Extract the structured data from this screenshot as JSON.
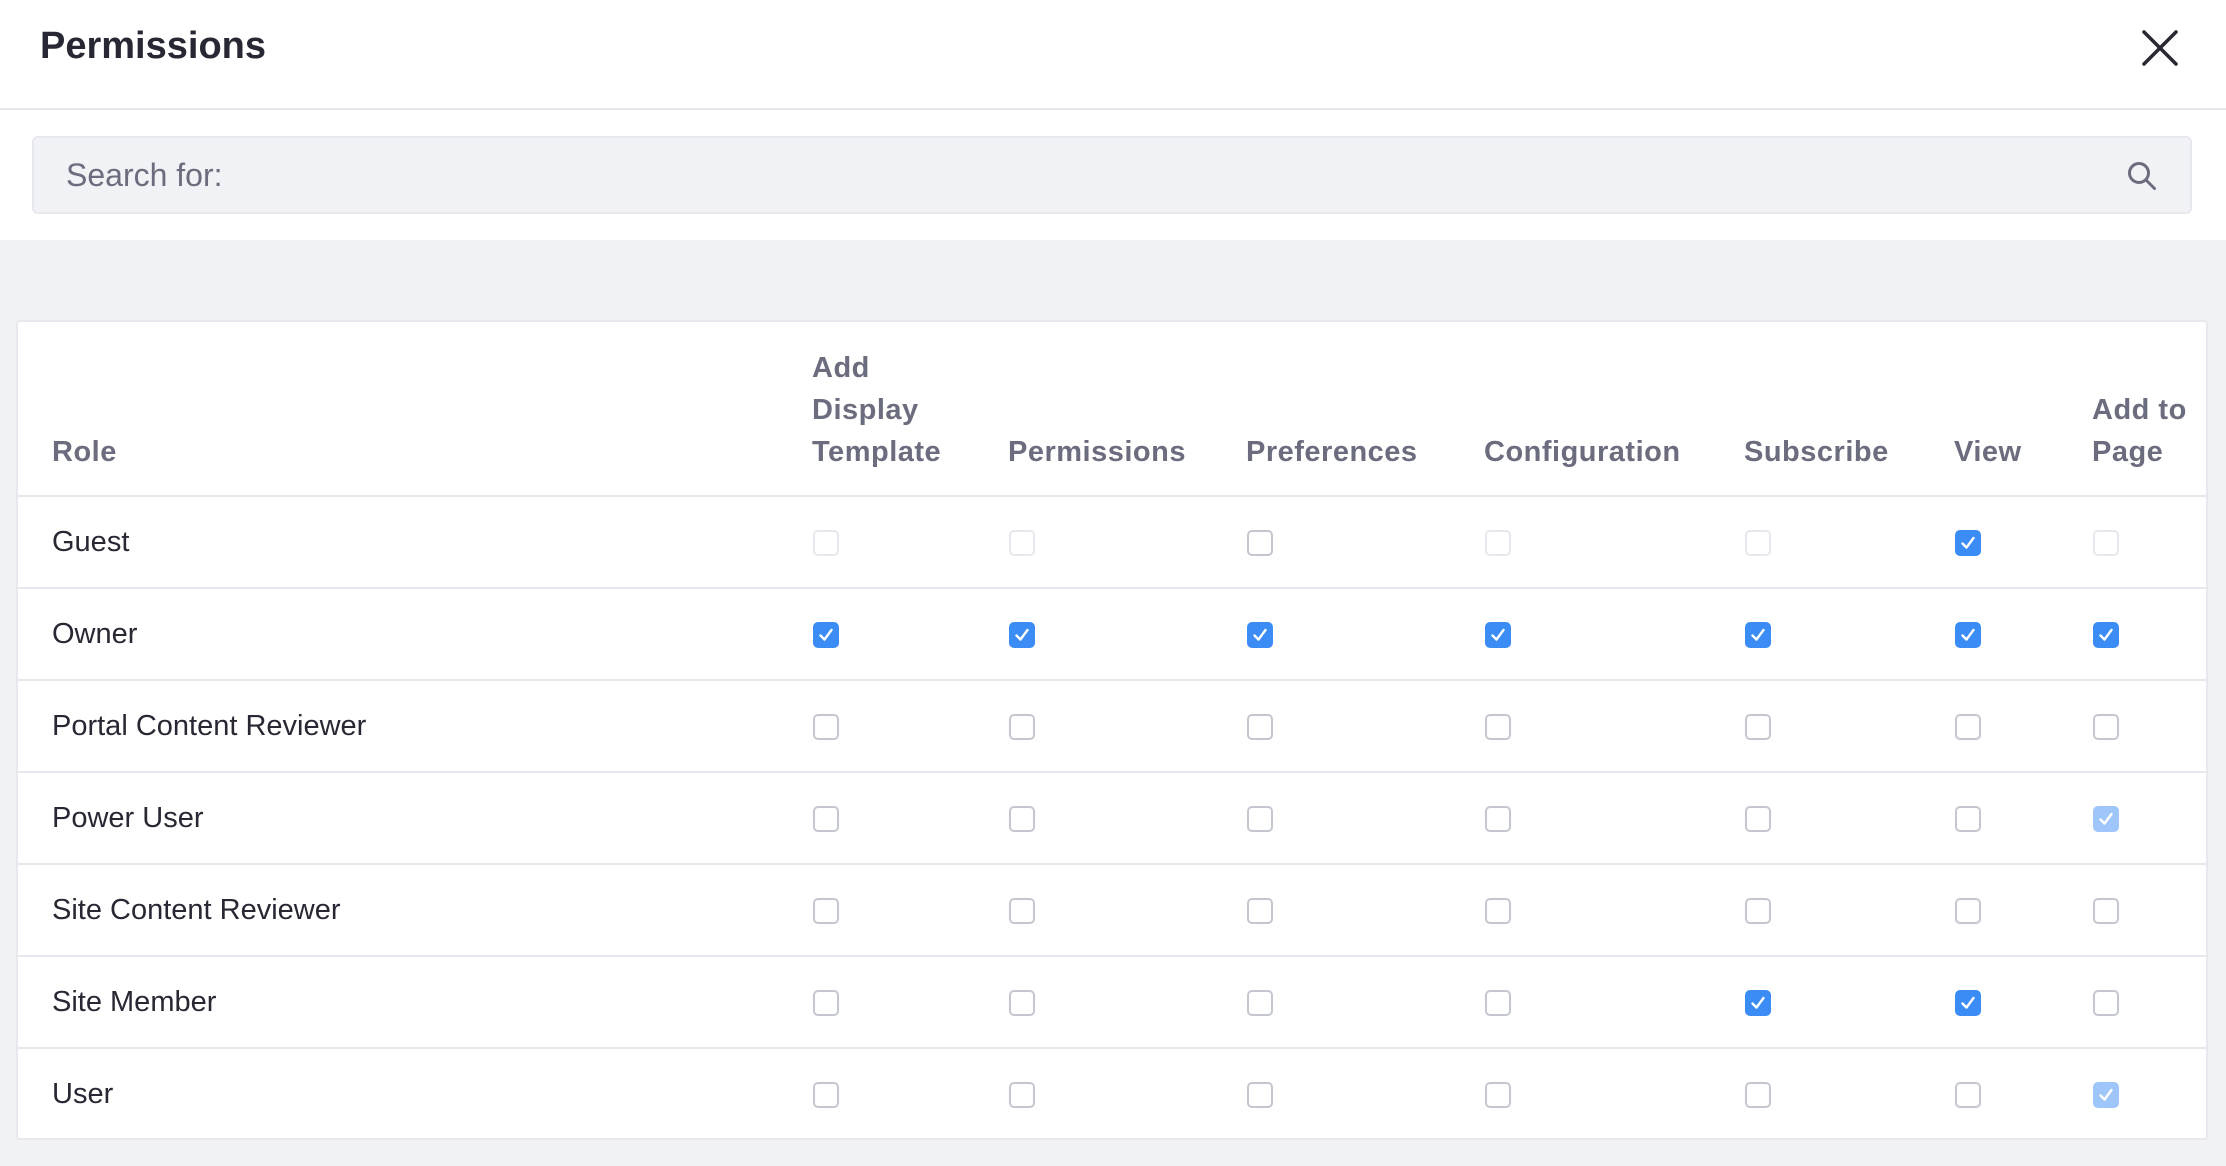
{
  "header": {
    "title": "Permissions"
  },
  "search": {
    "placeholder": "Search for:",
    "value": ""
  },
  "colors": {
    "accent": "#3b8cf5",
    "accent_disabled": "#9fc6fa"
  },
  "table": {
    "columns": [
      {
        "label": "Role"
      },
      {
        "label": "Add Display Template",
        "lines": [
          "Add",
          "Display",
          "Template"
        ]
      },
      {
        "label": "Permissions",
        "lines": [
          "Permissions"
        ]
      },
      {
        "label": "Preferences",
        "lines": [
          "Preferences"
        ]
      },
      {
        "label": "Configuration",
        "lines": [
          "Configuration"
        ]
      },
      {
        "label": "Subscribe",
        "lines": [
          "Subscribe"
        ]
      },
      {
        "label": "View",
        "lines": [
          "View"
        ]
      },
      {
        "label": "Add to Page",
        "lines": [
          "Add to",
          "Page"
        ]
      }
    ],
    "rows": [
      {
        "role": "Guest",
        "permissions": [
          {
            "checked": false,
            "disabled": true
          },
          {
            "checked": false,
            "disabled": true
          },
          {
            "checked": false,
            "disabled": false
          },
          {
            "checked": false,
            "disabled": true
          },
          {
            "checked": false,
            "disabled": true
          },
          {
            "checked": true,
            "disabled": false
          },
          {
            "checked": false,
            "disabled": true
          }
        ]
      },
      {
        "role": "Owner",
        "permissions": [
          {
            "checked": true,
            "disabled": false
          },
          {
            "checked": true,
            "disabled": false
          },
          {
            "checked": true,
            "disabled": false
          },
          {
            "checked": true,
            "disabled": false
          },
          {
            "checked": true,
            "disabled": false
          },
          {
            "checked": true,
            "disabled": false
          },
          {
            "checked": true,
            "disabled": false
          }
        ]
      },
      {
        "role": "Portal Content Reviewer",
        "permissions": [
          {
            "checked": false,
            "disabled": false
          },
          {
            "checked": false,
            "disabled": false
          },
          {
            "checked": false,
            "disabled": false
          },
          {
            "checked": false,
            "disabled": false
          },
          {
            "checked": false,
            "disabled": false
          },
          {
            "checked": false,
            "disabled": false
          },
          {
            "checked": false,
            "disabled": false
          }
        ]
      },
      {
        "role": "Power User",
        "permissions": [
          {
            "checked": false,
            "disabled": false
          },
          {
            "checked": false,
            "disabled": false
          },
          {
            "checked": false,
            "disabled": false
          },
          {
            "checked": false,
            "disabled": false
          },
          {
            "checked": false,
            "disabled": false
          },
          {
            "checked": false,
            "disabled": false
          },
          {
            "checked": true,
            "disabled": true
          }
        ]
      },
      {
        "role": "Site Content Reviewer",
        "permissions": [
          {
            "checked": false,
            "disabled": false
          },
          {
            "checked": false,
            "disabled": false
          },
          {
            "checked": false,
            "disabled": false
          },
          {
            "checked": false,
            "disabled": false
          },
          {
            "checked": false,
            "disabled": false
          },
          {
            "checked": false,
            "disabled": false
          },
          {
            "checked": false,
            "disabled": false
          }
        ]
      },
      {
        "role": "Site Member",
        "permissions": [
          {
            "checked": false,
            "disabled": false
          },
          {
            "checked": false,
            "disabled": false
          },
          {
            "checked": false,
            "disabled": false
          },
          {
            "checked": false,
            "disabled": false
          },
          {
            "checked": true,
            "disabled": false
          },
          {
            "checked": true,
            "disabled": false
          },
          {
            "checked": false,
            "disabled": false
          }
        ]
      },
      {
        "role": "User",
        "permissions": [
          {
            "checked": false,
            "disabled": false
          },
          {
            "checked": false,
            "disabled": false
          },
          {
            "checked": false,
            "disabled": false
          },
          {
            "checked": false,
            "disabled": false
          },
          {
            "checked": false,
            "disabled": false
          },
          {
            "checked": false,
            "disabled": false
          },
          {
            "checked": true,
            "disabled": true
          }
        ]
      }
    ]
  }
}
